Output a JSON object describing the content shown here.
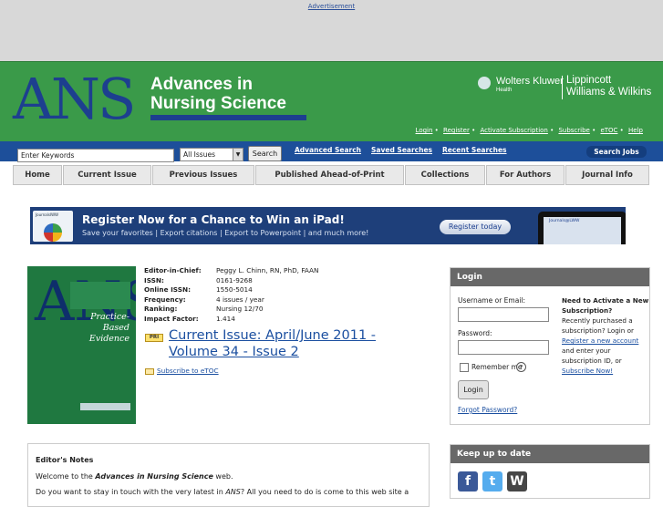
{
  "ad": {
    "link": "Advertisement"
  },
  "header": {
    "logo": "ANS",
    "title_line1": "Advances in",
    "title_line2": "Nursing Science",
    "publisher_name": "Wolters Kluwer",
    "publisher_sub": "Health",
    "publisher_right1": "Lippincott",
    "publisher_right2": "Williams & Wilkins"
  },
  "user_links": [
    "Login",
    "Register",
    "Activate Subscription",
    "Subscribe",
    "eTOC",
    "Help"
  ],
  "search": {
    "placeholder": "Enter Keywords",
    "scope": "All Issues",
    "button": "Search",
    "advanced": "Advanced Search",
    "saved": "Saved Searches",
    "recent": "Recent Searches",
    "jobs": "Search Jobs"
  },
  "nav": [
    "Home",
    "Current Issue",
    "Previous Issues",
    "Published Ahead-of-Print",
    "Collections",
    "For Authors",
    "Journal Info"
  ],
  "banner": {
    "headline": "Register Now for a Chance to Win an iPad!",
    "sub": "Save your favorites | Export citations | Export to Powerpoint | and much more!",
    "button": "Register today",
    "logo_text": "JournalsIWW",
    "ipad_text": "Journals@LWW"
  },
  "cover": {
    "title": "Practice-Based Evidence",
    "letters": "ANS"
  },
  "meta": [
    {
      "k": "Editor-in-Chief:",
      "v": "Peggy L. Chinn, RN, PhD, FAAN"
    },
    {
      "k": "ISSN:",
      "v": "0161-9268"
    },
    {
      "k": "Online ISSN:",
      "v": "1550-5014"
    },
    {
      "k": "Frequency:",
      "v": "4 issues / year"
    },
    {
      "k": "Ranking:",
      "v": "Nursing 12/70"
    },
    {
      "k": "Impact Factor:",
      "v": "1.414"
    }
  ],
  "current_issue": {
    "badge": "PRI",
    "line1": "Current Issue: April/June 2011 -",
    "line2": "Volume 34 - Issue 2",
    "etoc": "Subscribe to eTOC"
  },
  "notes": {
    "heading": "Editor's Notes",
    "p1_pre": "Welcome to the ",
    "p1_em": "Advances in Nursing Science",
    "p1_post": " web.",
    "p2_pre": "Do you want to stay in touch with the very latest in ",
    "p2_em": "ANS",
    "p2_post": "? All you need to do is come to this web site a"
  },
  "login": {
    "title": "Login",
    "username_label": "Username or Email:",
    "password_label": "Password:",
    "remember": "Remember me",
    "help": "?",
    "button": "Login",
    "forgot": "Forgot Password?",
    "need_title": "Need to Activate a New Subscription?",
    "need_text1": "Recently purchased a subscription? Login or",
    "need_link1": "Register a new account",
    "need_text2": "and enter your subscription ID, or",
    "need_link2": "Subscribe Now!"
  },
  "keep": {
    "title": "Keep up to date"
  },
  "colors": {
    "green": "#3a9a49",
    "navy": "#1d3f8f",
    "blue_bar": "#1d4f9a",
    "panel_header": "#686868"
  }
}
